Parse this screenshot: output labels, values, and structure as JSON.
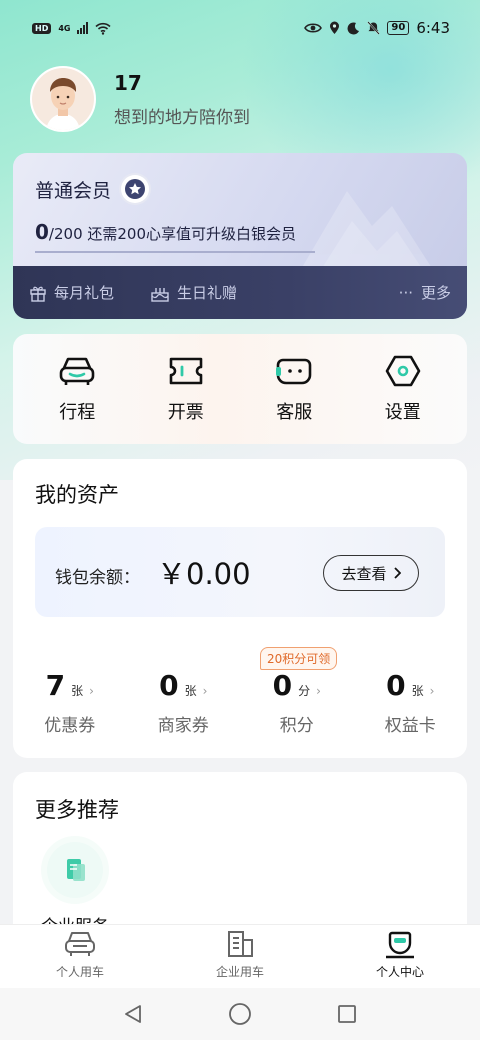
{
  "status_bar": {
    "hd": "HD",
    "network": "4G",
    "battery": "90",
    "time": "6:43"
  },
  "profile": {
    "name": "17",
    "slogan": "想到的地方陪你到"
  },
  "member": {
    "level": "普通会员",
    "points_current": "0",
    "points_target": "/200",
    "upgrade_hint": "还需200心享值可升级白银会员",
    "perks": [
      {
        "label": "每月礼包",
        "icon": "gift-icon"
      },
      {
        "label": "生日礼赠",
        "icon": "cake-icon"
      }
    ],
    "more_label": "更多",
    "more_dots": "···",
    "progress": 0
  },
  "actions": [
    {
      "label": "行程",
      "icon": "car-icon"
    },
    {
      "label": "开票",
      "icon": "ticket-icon"
    },
    {
      "label": "客服",
      "icon": "service-icon"
    },
    {
      "label": "设置",
      "icon": "settings-icon"
    }
  ],
  "assets": {
    "title": "我的资产",
    "wallet_label": "钱包余额：",
    "wallet_amount": "￥0.00",
    "wallet_button": "去查看",
    "items": [
      {
        "value": "7",
        "unit": "张",
        "name": "优惠券"
      },
      {
        "value": "0",
        "unit": "张",
        "name": "商家券"
      },
      {
        "value": "0",
        "unit": "分",
        "name": "积分",
        "badge": "20积分可领"
      },
      {
        "value": "0",
        "unit": "张",
        "name": "权益卡"
      }
    ]
  },
  "recommend": {
    "title": "更多推荐",
    "items": [
      {
        "label": "企业服务",
        "icon": "enterprise-service-icon"
      }
    ]
  },
  "tabs": [
    {
      "label": "个人用车",
      "icon": "car-outline-icon",
      "active": false
    },
    {
      "label": "企业用车",
      "icon": "building-icon",
      "active": false
    },
    {
      "label": "个人中心",
      "icon": "person-icon",
      "active": true
    }
  ],
  "colors": {
    "accent": "#2fc9a8",
    "member_dark": "#2f3556",
    "badge_orange": "#e06a2a"
  }
}
